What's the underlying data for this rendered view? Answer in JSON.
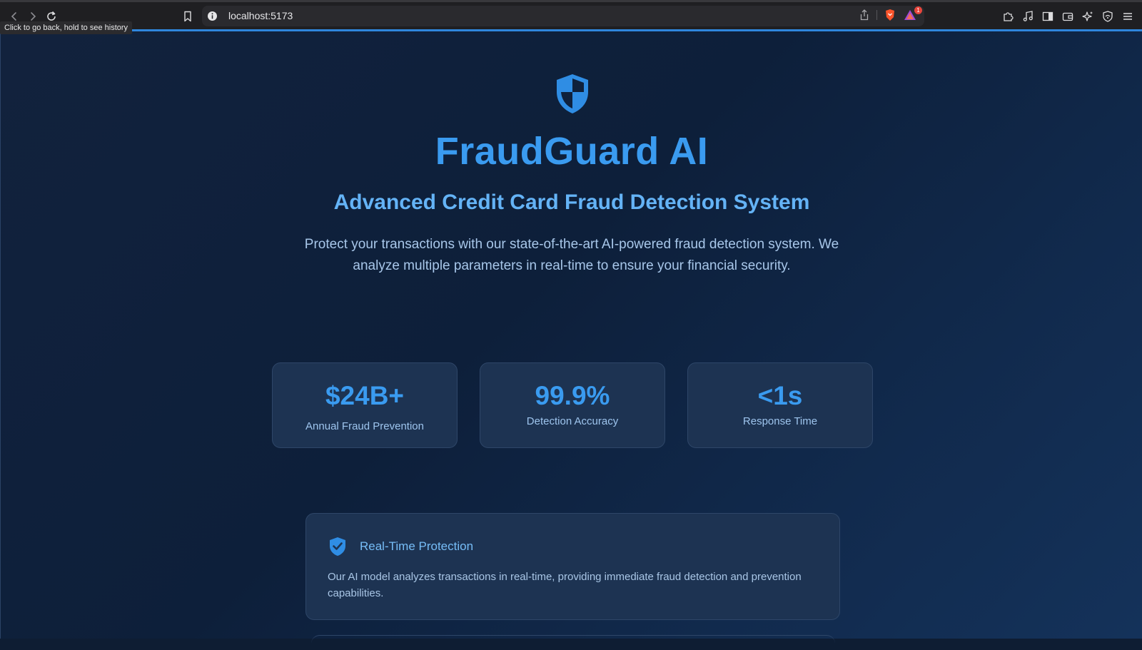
{
  "browser": {
    "url": "localhost:5173",
    "tooltip": "Click to go back, hold to see history",
    "alert_count": "1",
    "icons": [
      "back-icon",
      "forward-icon",
      "reload-icon",
      "bookmark-icon",
      "info-icon",
      "share-icon",
      "brave-shield-icon",
      "brave-rewards-icon",
      "extensions-icon",
      "media-icon",
      "sidebar-icon",
      "wallet-icon",
      "leo-ai-icon",
      "vpn-icon",
      "menu-icon"
    ]
  },
  "hero": {
    "icon": "shield-icon",
    "title": "FraudGuard AI",
    "subtitle": "Advanced Credit Card Fraud Detection System",
    "description": "Protect your transactions with our state-of-the-art AI-powered fraud detection system. We analyze multiple parameters in real-time to ensure your financial security."
  },
  "stats": [
    {
      "value": "$24B+",
      "label": "Annual Fraud Prevention"
    },
    {
      "value": "99.9%",
      "label": "Detection Accuracy"
    },
    {
      "value": "<1s",
      "label": "Response Time"
    }
  ],
  "features": [
    {
      "icon": "shield-check-icon",
      "title": "Real-Time Protection",
      "text": "Our AI model analyzes transactions in real-time, providing immediate fraud detection and prevention capabilities."
    }
  ],
  "colors": {
    "accent": "#3a9bf0",
    "subtitle": "#64b3f6",
    "card_bg": "#1d3352",
    "page_bg": "#0e1d33"
  }
}
